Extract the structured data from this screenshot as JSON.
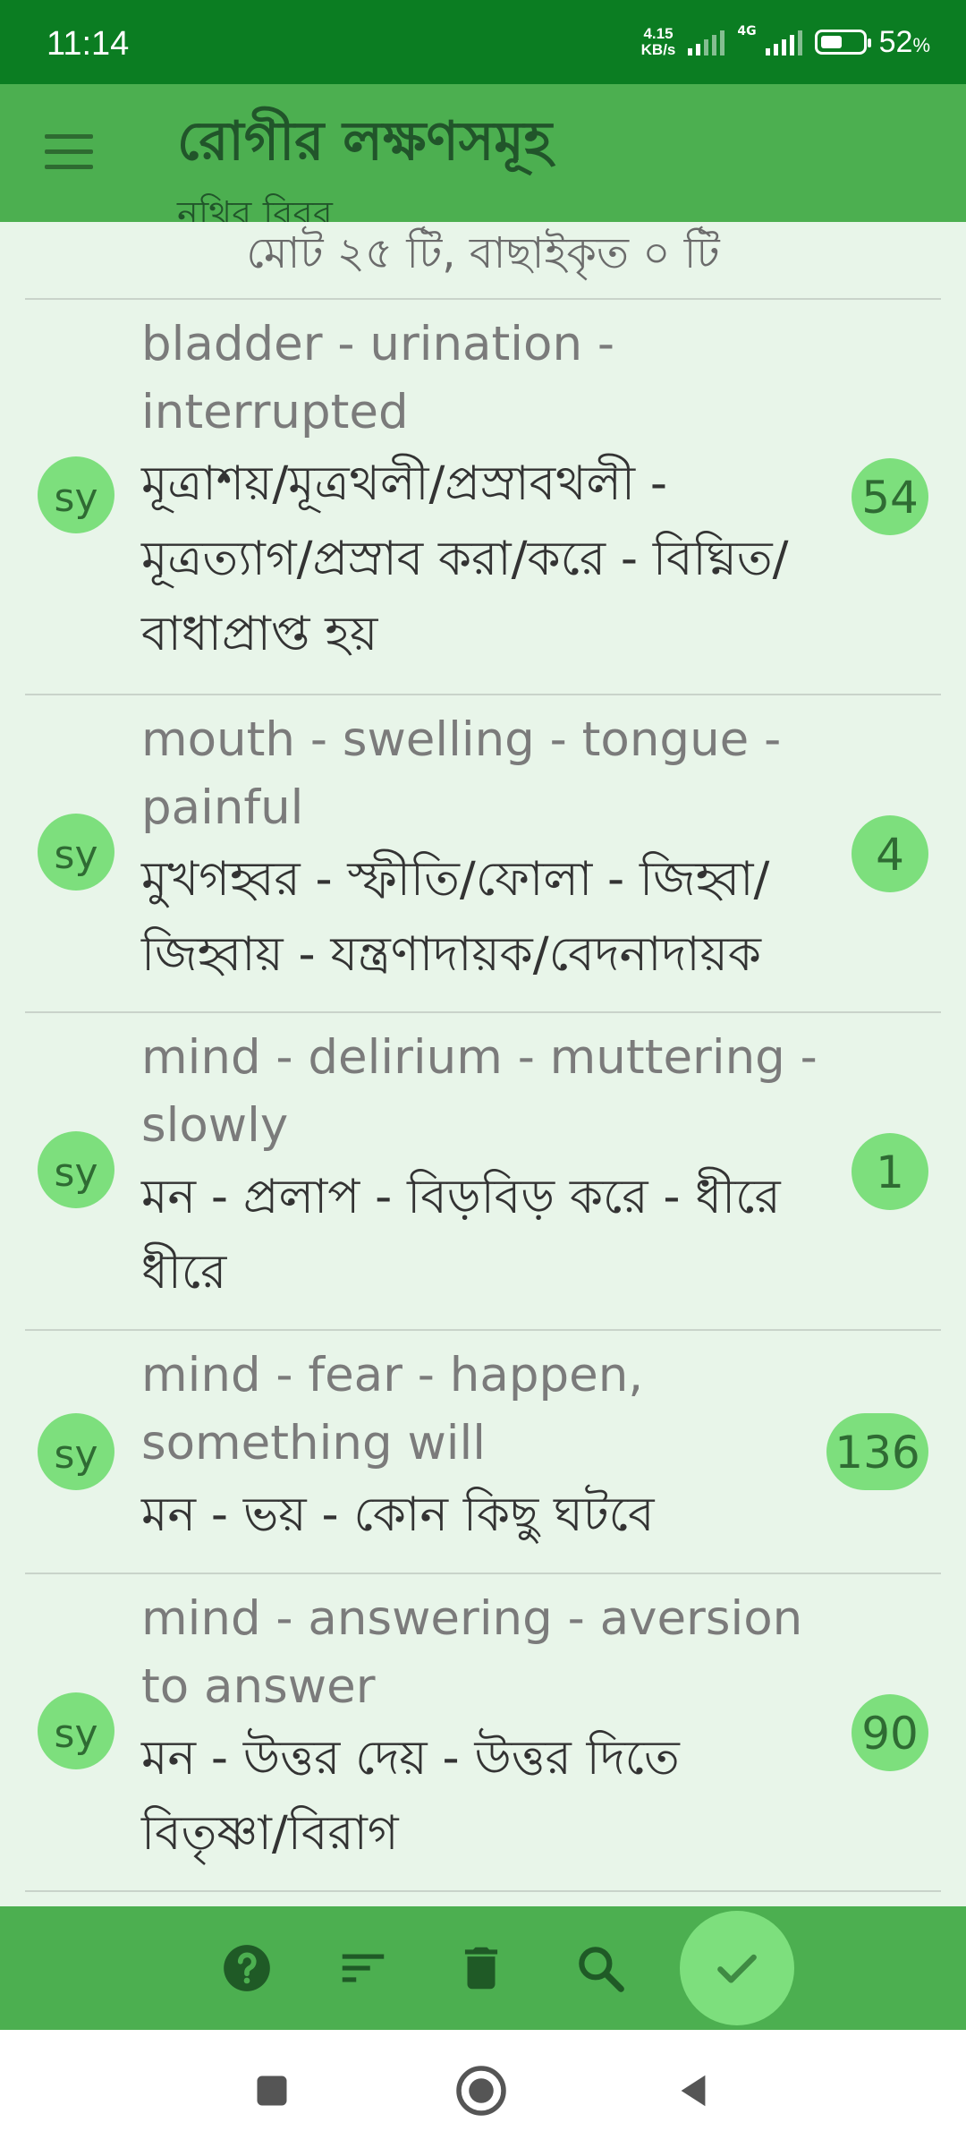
{
  "status_bar": {
    "time": "11:14",
    "speed_value": "4.15",
    "speed_unit": "KB/s",
    "network": "4G",
    "battery_percent": "52",
    "battery_level": 0.52
  },
  "app_bar": {
    "title": "রোগীর লক্ষণসমূহ",
    "subtitle": "নথির বিবর"
  },
  "summary": "মোট ২৫ টি, বাছাইকৃত ০ টি",
  "rows": [
    {
      "badge": "sy",
      "en_lines": [
        "bladder - urination -",
        "interrupted"
      ],
      "bn_lines": [
        "মূত্রাশয়/মূত্রথলী/প্রস্রাবথলী -",
        "মূত্রত্যাগ/প্রস্রাব করা/করে - বিঘ্নিত/",
        "বাধাপ্রাপ্ত হয়"
      ],
      "count": "54"
    },
    {
      "badge": "sy",
      "en_lines": [
        "mouth - swelling - tongue -",
        "painful"
      ],
      "bn_lines": [
        "মুখগহ্বর - স্ফীতি/ফোলা - জিহ্বা/",
        "জিহ্বায় - যন্ত্রণাদায়ক/বেদনাদায়ক"
      ],
      "count": "4"
    },
    {
      "badge": "sy",
      "en_lines": [
        "mind - delirium - muttering -",
        "slowly"
      ],
      "bn_lines": [
        "মন - প্রলাপ - বিড়বিড় করে - ধীরে",
        "ধীরে"
      ],
      "count": "1"
    },
    {
      "badge": "sy",
      "en_lines": [
        "mind - fear - happen,",
        "something will"
      ],
      "bn_lines": [
        "মন - ভয় - কোন কিছু ঘটবে"
      ],
      "count": "136"
    },
    {
      "badge": "sy",
      "en_lines": [
        "mind - answering - aversion",
        "to answer"
      ],
      "bn_lines": [
        "মন - উত্তর দেয় - উত্তর দিতে",
        "বিতৃষ্ণা/বিরাগ"
      ],
      "count": "90"
    }
  ],
  "toolbar": {
    "icons": [
      "help-icon",
      "sort-icon",
      "delete-icon",
      "search-icon",
      "check-icon"
    ]
  },
  "nav": {
    "icons": [
      "recents-square-icon",
      "home-circle-icon",
      "back-triangle-icon"
    ]
  },
  "colors": {
    "status_bar": "#0b7d22",
    "app_bar": "#4caf50",
    "background": "#e8f5e9",
    "badge": "#7ddf7d",
    "toolbar_icon": "#1f5a26"
  }
}
